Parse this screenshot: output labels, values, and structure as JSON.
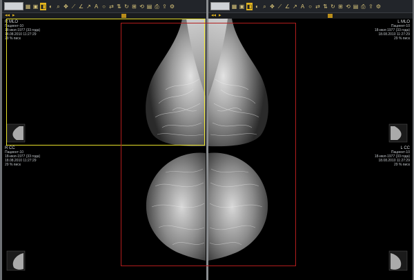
{
  "views": {
    "r_mlo": {
      "label": "R MLO",
      "patient": "Пациент-10",
      "date": "18-июл-1977 (33 года)",
      "time": "18.08.2010 11:27:29",
      "zoom": "29 % писк"
    },
    "l_mlo": {
      "label": "L MLO",
      "patient": "Пациент-10",
      "date": "18-июл-1977 (33 года)",
      "time": "18.08.2010 11:27:29",
      "zoom": "29 % писк"
    },
    "r_cc": {
      "label": "R CC",
      "patient": "Пациент-10",
      "date": "18-июл-1977 (33 года)",
      "time": "18.08.2010 11:27:29",
      "zoom": "29 % писк"
    },
    "l_cc": {
      "label": "L CC",
      "patient": "Пациент-10",
      "date": "18-июл-1977 (33 года)",
      "time": "18.08.2010 11:27:29",
      "zoom": "29 % писк"
    }
  },
  "toolbar": {
    "icons": [
      "series-icon",
      "layout-icon",
      "window-icon",
      "invert-icon",
      "zoom-icon",
      "pan-icon",
      "measure-icon",
      "angle-icon",
      "arrow-icon",
      "text-icon",
      "ellipse-icon",
      "sync-icon",
      "flip-icon",
      "rotate-icon",
      "compare-icon",
      "reset-icon",
      "undo-icon",
      "save-icon",
      "print-icon",
      "export-icon",
      "settings-icon"
    ],
    "active_icon": "window-icon"
  },
  "colors": {
    "selection": "#e8e02a",
    "roi": "#b31d1d",
    "toolbar_accent": "#e3b51e"
  }
}
